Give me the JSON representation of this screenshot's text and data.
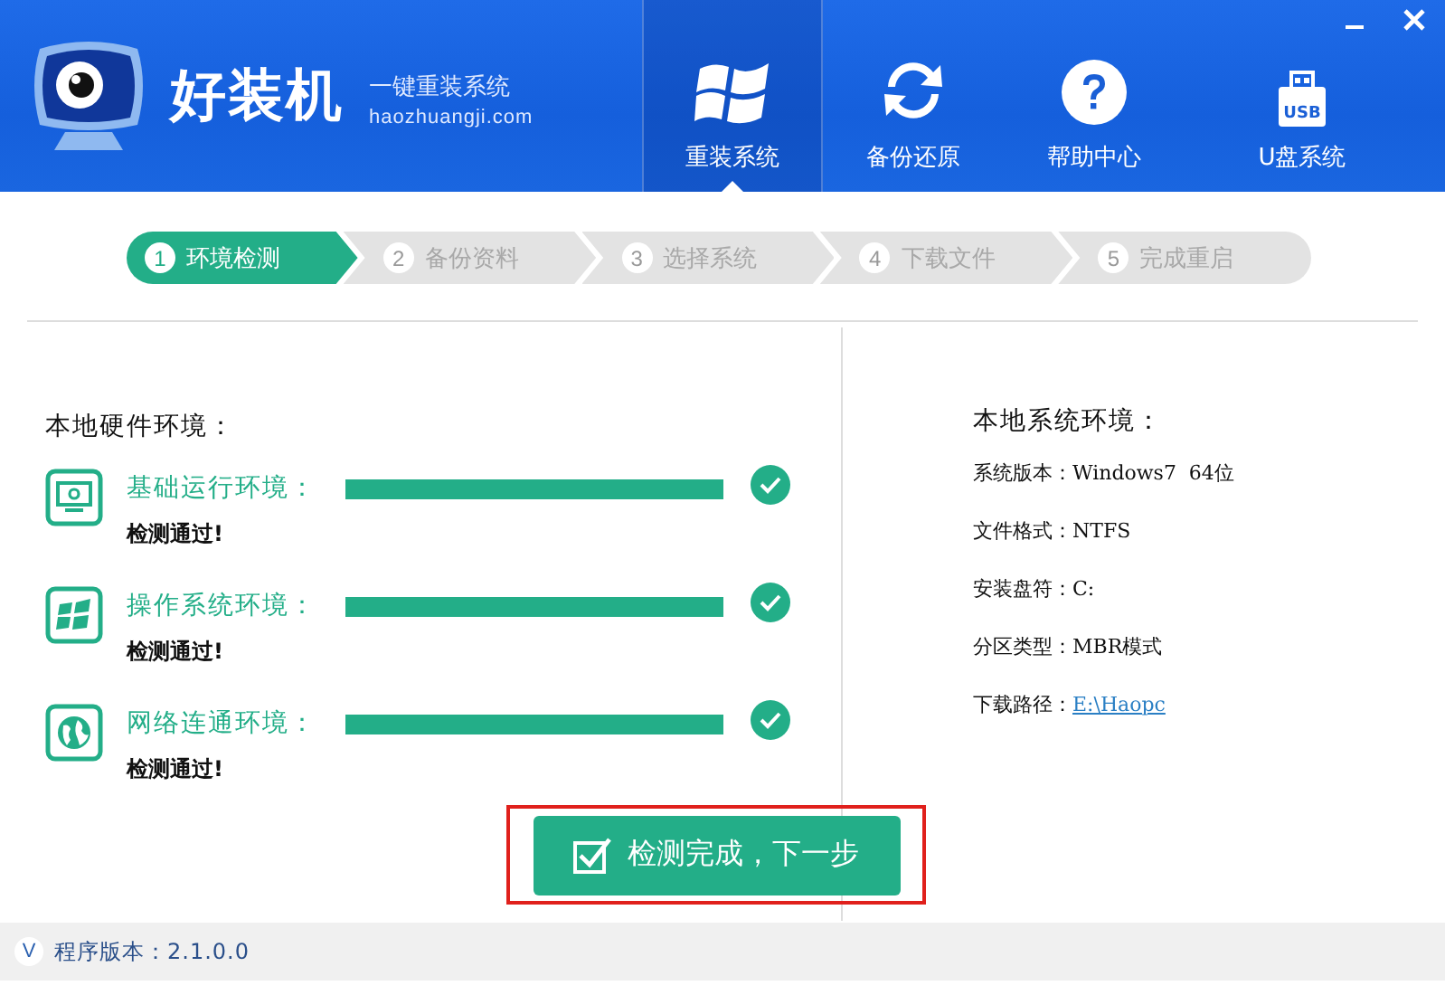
{
  "header": {
    "title": "好装机",
    "slogan": "一键重装系统",
    "website": "haozhuangji.com"
  },
  "nav_tabs": [
    {
      "kind": "windows",
      "label": "重装系统",
      "selected": true
    },
    {
      "kind": "sync",
      "label": "备份还原",
      "selected": false
    },
    {
      "kind": "help",
      "label": "帮助中心",
      "selected": false
    },
    {
      "kind": "usb",
      "label": "U盘系统",
      "selected": false
    }
  ],
  "usb_icon_text": "USB",
  "steps": [
    {
      "number": "1",
      "label": "环境检测",
      "selected": true
    },
    {
      "number": "2",
      "label": "备份资料",
      "selected": false
    },
    {
      "number": "3",
      "label": "选择系统",
      "selected": false
    },
    {
      "number": "4",
      "label": "下载文件",
      "selected": false
    },
    {
      "number": "5",
      "label": "完成重启",
      "selected": false
    }
  ],
  "hardware": {
    "title": "本地硬件环境：",
    "items": [
      {
        "kind": "monitor",
        "label": "基础运行环境：",
        "level": 1,
        "status": "检测通过!",
        "passed": true
      },
      {
        "kind": "windows",
        "label": "操作系统环境：",
        "level": 1,
        "status": "检测通过!",
        "passed": true
      },
      {
        "kind": "globe",
        "label": "网络连通环境：",
        "level": 1,
        "status": "检测通过!",
        "passed": true
      }
    ]
  },
  "system": {
    "title": "本地系统环境：",
    "rows": [
      {
        "kind": "text",
        "label": "系统版本：",
        "value": "Windows7  64位"
      },
      {
        "kind": "text",
        "label": "文件格式：",
        "value": "NTFS"
      },
      {
        "kind": "text",
        "label": "安装盘符：",
        "value": "C:"
      },
      {
        "kind": "text",
        "label": "分区类型：",
        "value": "MBR模式"
      },
      {
        "kind": "link",
        "label": "下载路径：",
        "value": "E:\\Haopc"
      }
    ]
  },
  "next_button": {
    "label": "检测完成，下一步",
    "highlighted": true
  },
  "footer": {
    "badge": "V",
    "version": "程序版本：2.1.0.0"
  }
}
